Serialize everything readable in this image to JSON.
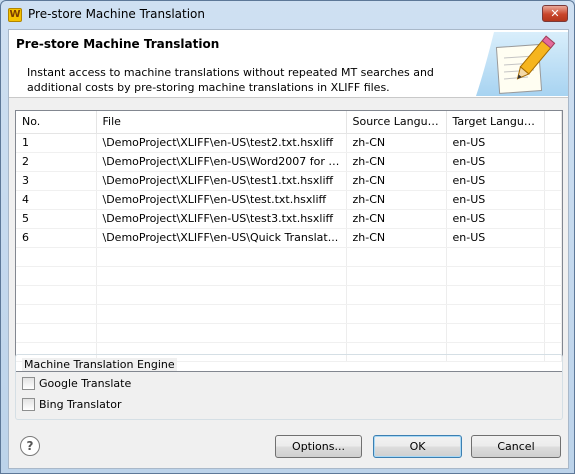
{
  "window": {
    "title": "Pre-store Machine Translation",
    "close_label": "✕"
  },
  "header": {
    "title": "Pre-store Machine Translation",
    "description": "Instant access to machine translations without repeated MT searches and additional costs by pre-storing machine translations in XLIFF files."
  },
  "table": {
    "columns": [
      "No.",
      "File",
      "Source Langua...",
      "Target Langua..."
    ],
    "rows": [
      {
        "no": "1",
        "file": "\\DemoProject\\XLIFF\\en-US\\test2.txt.hsxliff",
        "source": "zh-CN",
        "target": "en-US"
      },
      {
        "no": "2",
        "file": "\\DemoProject\\XLIFF\\en-US\\Word2007 for t...",
        "source": "zh-CN",
        "target": "en-US"
      },
      {
        "no": "3",
        "file": "\\DemoProject\\XLIFF\\en-US\\test1.txt.hsxliff",
        "source": "zh-CN",
        "target": "en-US"
      },
      {
        "no": "4",
        "file": "\\DemoProject\\XLIFF\\en-US\\test.txt.hsxliff",
        "source": "zh-CN",
        "target": "en-US"
      },
      {
        "no": "5",
        "file": "\\DemoProject\\XLIFF\\en-US\\test3.txt.hsxliff",
        "source": "zh-CN",
        "target": "en-US"
      },
      {
        "no": "6",
        "file": "\\DemoProject\\XLIFF\\en-US\\Quick Translat...",
        "source": "zh-CN",
        "target": "en-US"
      }
    ],
    "empty_rows": 6
  },
  "engine_group": {
    "label": "Machine Translation Engine",
    "options": [
      {
        "label": "Google Translate",
        "checked": false
      },
      {
        "label": "Bing Translator",
        "checked": false
      }
    ]
  },
  "footer": {
    "help_icon": "question-icon",
    "options_label": "Options...",
    "ok_label": "OK",
    "cancel_label": "Cancel"
  }
}
